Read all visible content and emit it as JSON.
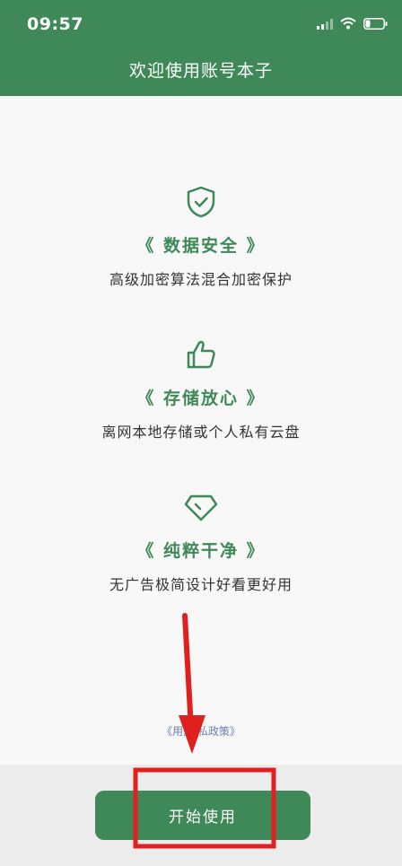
{
  "status_bar": {
    "time": "09:57"
  },
  "header": {
    "title": "欢迎使用账号本子"
  },
  "features": [
    {
      "icon": "shield-check-icon",
      "title": "《 数据安全 》",
      "desc": "高级加密算法混合加密保护"
    },
    {
      "icon": "thumbs-up-icon",
      "title": "《 存储放心 》",
      "desc": "离网本地存储或个人私有云盘"
    },
    {
      "icon": "diamond-icon",
      "title": "《 纯粹干净 》",
      "desc": "无广告极简设计好看更好用"
    }
  ],
  "privacy_link": "《用户 私政策》",
  "start_button": "开始使用",
  "colors": {
    "brand": "#3f8857",
    "annotation": "#e0201f",
    "link": "#6b7fb0"
  }
}
